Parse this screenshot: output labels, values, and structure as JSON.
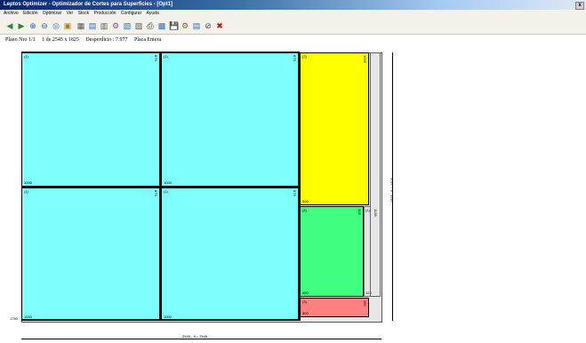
{
  "window": {
    "title": "Leptos Optimizer - Optimizador de Cortes para Superficies - [Opt1]",
    "close_label": "x"
  },
  "menu": [
    "Archivo",
    "Edición",
    "Optimizar",
    "Ver",
    "Stock",
    "Producción",
    "Configurar",
    "Ayuda"
  ],
  "toolbar": {
    "icons": [
      "back-icon",
      "forward-icon",
      "zoom-in-icon",
      "zoom-out-icon",
      "view-icon",
      "open-icon",
      "table-icon",
      "sheet-icon",
      "calculator-icon",
      "network-icon",
      "chart-icon",
      "grid-icon",
      "print-icon",
      "export-icon",
      "save-icon",
      "settings-icon",
      "document-icon",
      "stop-icon",
      "cancel-icon"
    ],
    "glyphs": [
      "◀",
      "▶",
      "⊕",
      "⊖",
      "◎",
      "▣",
      "▦",
      "▤",
      "▥",
      "⚙",
      "▧",
      "▨",
      "⎙",
      "▩",
      "💾",
      "⚙",
      "▤",
      "⊘",
      "✖"
    ],
    "colors": [
      "#2a8a2a",
      "#2a8a2a",
      "#1c5fb0",
      "#1c5fb0",
      "#2b6fb8",
      "#b07a16",
      "#555555",
      "#2b6fb8",
      "#555555",
      "#7a4f9a",
      "#2b6fb8",
      "#555555",
      "#333333",
      "#2b6fb8",
      "#1c5fb0",
      "#7a6a2a",
      "#2b6fb8",
      "#444444",
      "#cc1111"
    ]
  },
  "info": {
    "plano": "Plano Nro 1/1",
    "placa": "1 de 2545 x 1825",
    "desperdicio": "Desperdicio : 7.977",
    "tipo": "Placa Entera"
  },
  "pieces": [
    {
      "id": "(1)",
      "w": "1000",
      "h": "875",
      "color": "#80ffff"
    },
    {
      "id": "(1)",
      "w": "1000",
      "h": "875",
      "color": "#80ffff"
    },
    {
      "id": "(1)",
      "w": "1000",
      "h": "875",
      "color": "#80ffff"
    },
    {
      "id": "(1)",
      "w": "1000",
      "h": "875",
      "color": "#80ffff"
    },
    {
      "id": "(2)",
      "w": "500",
      "h": "1000",
      "color": "#ffff00"
    },
    {
      "id": "(4)",
      "w": "450",
      "h": "500",
      "color": "#40ff80"
    },
    {
      "id": "(3)",
      "w": "500",
      "h": "150",
      "color": "#ff8080"
    }
  ],
  "waste": {
    "id": "(1)",
    "w": "123",
    "h": "1138"
  },
  "dims": {
    "bottom": "2545 - 8 = 2545",
    "right": "1825 - 8 = 1825",
    "left_offset": "1750"
  },
  "colors": {
    "cut": "#000000",
    "plate": "#e6e6e6"
  }
}
